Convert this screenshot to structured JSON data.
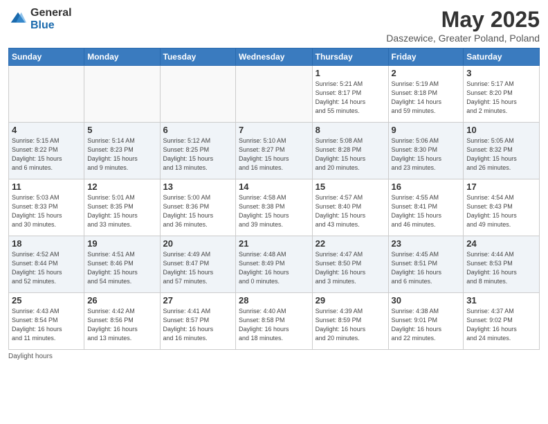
{
  "header": {
    "logo_general": "General",
    "logo_blue": "Blue",
    "month_title": "May 2025",
    "location": "Daszewice, Greater Poland, Poland"
  },
  "days_of_week": [
    "Sunday",
    "Monday",
    "Tuesday",
    "Wednesday",
    "Thursday",
    "Friday",
    "Saturday"
  ],
  "weeks": [
    [
      {
        "num": "",
        "info": ""
      },
      {
        "num": "",
        "info": ""
      },
      {
        "num": "",
        "info": ""
      },
      {
        "num": "",
        "info": ""
      },
      {
        "num": "1",
        "info": "Sunrise: 5:21 AM\nSunset: 8:17 PM\nDaylight: 14 hours\nand 55 minutes."
      },
      {
        "num": "2",
        "info": "Sunrise: 5:19 AM\nSunset: 8:18 PM\nDaylight: 14 hours\nand 59 minutes."
      },
      {
        "num": "3",
        "info": "Sunrise: 5:17 AM\nSunset: 8:20 PM\nDaylight: 15 hours\nand 2 minutes."
      }
    ],
    [
      {
        "num": "4",
        "info": "Sunrise: 5:15 AM\nSunset: 8:22 PM\nDaylight: 15 hours\nand 6 minutes."
      },
      {
        "num": "5",
        "info": "Sunrise: 5:14 AM\nSunset: 8:23 PM\nDaylight: 15 hours\nand 9 minutes."
      },
      {
        "num": "6",
        "info": "Sunrise: 5:12 AM\nSunset: 8:25 PM\nDaylight: 15 hours\nand 13 minutes."
      },
      {
        "num": "7",
        "info": "Sunrise: 5:10 AM\nSunset: 8:27 PM\nDaylight: 15 hours\nand 16 minutes."
      },
      {
        "num": "8",
        "info": "Sunrise: 5:08 AM\nSunset: 8:28 PM\nDaylight: 15 hours\nand 20 minutes."
      },
      {
        "num": "9",
        "info": "Sunrise: 5:06 AM\nSunset: 8:30 PM\nDaylight: 15 hours\nand 23 minutes."
      },
      {
        "num": "10",
        "info": "Sunrise: 5:05 AM\nSunset: 8:32 PM\nDaylight: 15 hours\nand 26 minutes."
      }
    ],
    [
      {
        "num": "11",
        "info": "Sunrise: 5:03 AM\nSunset: 8:33 PM\nDaylight: 15 hours\nand 30 minutes."
      },
      {
        "num": "12",
        "info": "Sunrise: 5:01 AM\nSunset: 8:35 PM\nDaylight: 15 hours\nand 33 minutes."
      },
      {
        "num": "13",
        "info": "Sunrise: 5:00 AM\nSunset: 8:36 PM\nDaylight: 15 hours\nand 36 minutes."
      },
      {
        "num": "14",
        "info": "Sunrise: 4:58 AM\nSunset: 8:38 PM\nDaylight: 15 hours\nand 39 minutes."
      },
      {
        "num": "15",
        "info": "Sunrise: 4:57 AM\nSunset: 8:40 PM\nDaylight: 15 hours\nand 43 minutes."
      },
      {
        "num": "16",
        "info": "Sunrise: 4:55 AM\nSunset: 8:41 PM\nDaylight: 15 hours\nand 46 minutes."
      },
      {
        "num": "17",
        "info": "Sunrise: 4:54 AM\nSunset: 8:43 PM\nDaylight: 15 hours\nand 49 minutes."
      }
    ],
    [
      {
        "num": "18",
        "info": "Sunrise: 4:52 AM\nSunset: 8:44 PM\nDaylight: 15 hours\nand 52 minutes."
      },
      {
        "num": "19",
        "info": "Sunrise: 4:51 AM\nSunset: 8:46 PM\nDaylight: 15 hours\nand 54 minutes."
      },
      {
        "num": "20",
        "info": "Sunrise: 4:49 AM\nSunset: 8:47 PM\nDaylight: 15 hours\nand 57 minutes."
      },
      {
        "num": "21",
        "info": "Sunrise: 4:48 AM\nSunset: 8:49 PM\nDaylight: 16 hours\nand 0 minutes."
      },
      {
        "num": "22",
        "info": "Sunrise: 4:47 AM\nSunset: 8:50 PM\nDaylight: 16 hours\nand 3 minutes."
      },
      {
        "num": "23",
        "info": "Sunrise: 4:45 AM\nSunset: 8:51 PM\nDaylight: 16 hours\nand 6 minutes."
      },
      {
        "num": "24",
        "info": "Sunrise: 4:44 AM\nSunset: 8:53 PM\nDaylight: 16 hours\nand 8 minutes."
      }
    ],
    [
      {
        "num": "25",
        "info": "Sunrise: 4:43 AM\nSunset: 8:54 PM\nDaylight: 16 hours\nand 11 minutes."
      },
      {
        "num": "26",
        "info": "Sunrise: 4:42 AM\nSunset: 8:56 PM\nDaylight: 16 hours\nand 13 minutes."
      },
      {
        "num": "27",
        "info": "Sunrise: 4:41 AM\nSunset: 8:57 PM\nDaylight: 16 hours\nand 16 minutes."
      },
      {
        "num": "28",
        "info": "Sunrise: 4:40 AM\nSunset: 8:58 PM\nDaylight: 16 hours\nand 18 minutes."
      },
      {
        "num": "29",
        "info": "Sunrise: 4:39 AM\nSunset: 8:59 PM\nDaylight: 16 hours\nand 20 minutes."
      },
      {
        "num": "30",
        "info": "Sunrise: 4:38 AM\nSunset: 9:01 PM\nDaylight: 16 hours\nand 22 minutes."
      },
      {
        "num": "31",
        "info": "Sunrise: 4:37 AM\nSunset: 9:02 PM\nDaylight: 16 hours\nand 24 minutes."
      }
    ]
  ],
  "footer": "Daylight hours"
}
